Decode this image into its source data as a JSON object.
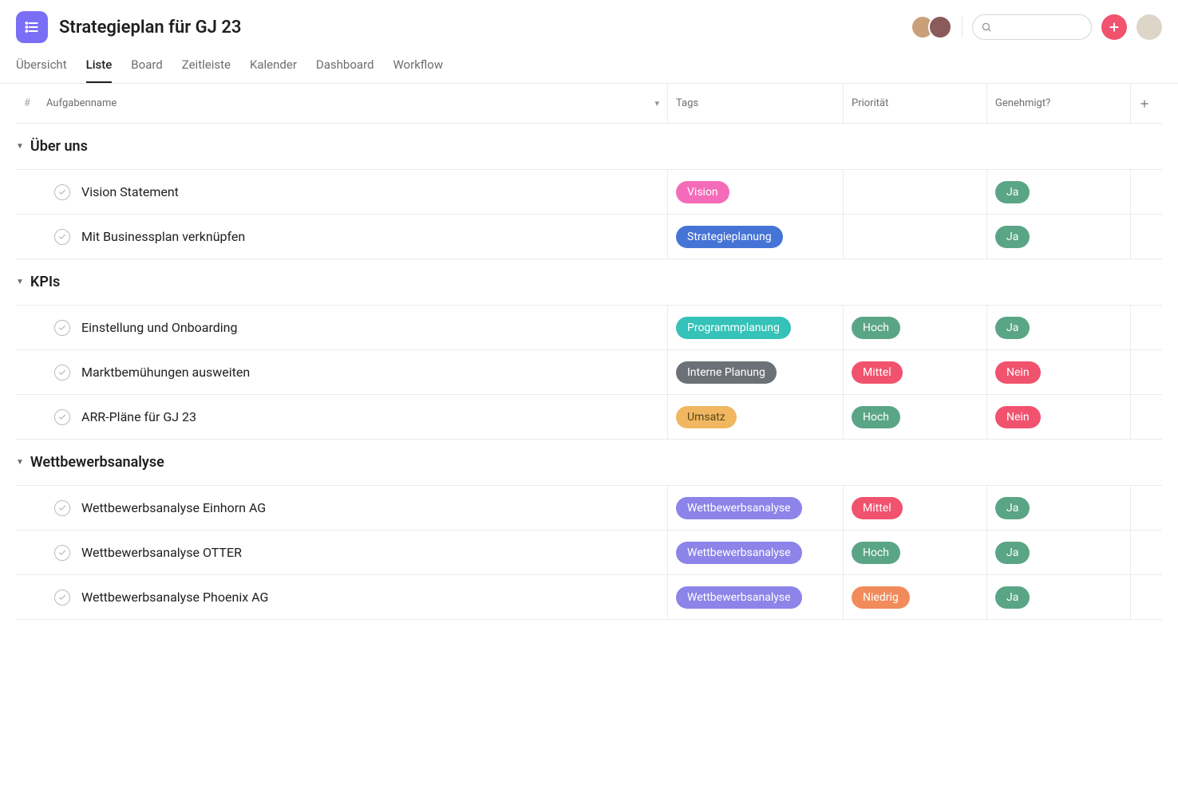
{
  "header": {
    "title": "Strategieplan für GJ 23"
  },
  "tabs": [
    {
      "id": "uebersicht",
      "label": "Übersicht",
      "active": false
    },
    {
      "id": "liste",
      "label": "Liste",
      "active": true
    },
    {
      "id": "board",
      "label": "Board",
      "active": false
    },
    {
      "id": "zeitleiste",
      "label": "Zeitleiste",
      "active": false
    },
    {
      "id": "kalender",
      "label": "Kalender",
      "active": false
    },
    {
      "id": "dashboard",
      "label": "Dashboard",
      "active": false
    },
    {
      "id": "workflow",
      "label": "Workflow",
      "active": false
    }
  ],
  "columns": {
    "num": "#",
    "name": "Aufgabenname",
    "tags": "Tags",
    "priority": "Priorität",
    "approved": "Genehmigt?"
  },
  "sections": [
    {
      "id": "ueber-uns",
      "title": "Über uns",
      "rows": [
        {
          "name": "Vision Statement",
          "tag": "Vision",
          "tagClass": "tag-vision",
          "priority": "",
          "prioClass": "",
          "approved": "Ja",
          "apprClass": "appr-ja"
        },
        {
          "name": "Mit Businessplan verknüpfen",
          "tag": "Strategieplanung",
          "tagClass": "tag-strategieplanung",
          "priority": "",
          "prioClass": "",
          "approved": "Ja",
          "apprClass": "appr-ja"
        }
      ]
    },
    {
      "id": "kpis",
      "title": "KPIs",
      "rows": [
        {
          "name": "Einstellung und Onboarding",
          "tag": "Programmplanung",
          "tagClass": "tag-programmplanung",
          "priority": "Hoch",
          "prioClass": "prio-hoch",
          "approved": "Ja",
          "apprClass": "appr-ja"
        },
        {
          "name": "Marktbemühungen ausweiten",
          "tag": "Interne Planung",
          "tagClass": "tag-interne-planung",
          "priority": "Mittel",
          "prioClass": "prio-mittel",
          "approved": "Nein",
          "apprClass": "appr-nein"
        },
        {
          "name": "ARR-Pläne für GJ 23",
          "tag": "Umsatz",
          "tagClass": "tag-umsatz",
          "priority": "Hoch",
          "prioClass": "prio-hoch",
          "approved": "Nein",
          "apprClass": "appr-nein"
        }
      ]
    },
    {
      "id": "wettbewerb",
      "title": "Wettbewerbsanalyse",
      "rows": [
        {
          "name": "Wettbewerbsanalyse Einhorn AG",
          "tag": "Wettbewerbsanalyse",
          "tagClass": "tag-wettbewerbsanalyse",
          "priority": "Mittel",
          "prioClass": "prio-mittel",
          "approved": "Ja",
          "apprClass": "appr-ja"
        },
        {
          "name": "Wettbewerbsanalyse OTTER",
          "tag": "Wettbewerbsanalyse",
          "tagClass": "tag-wettbewerbsanalyse",
          "priority": "Hoch",
          "prioClass": "prio-hoch",
          "approved": "Ja",
          "apprClass": "appr-ja"
        },
        {
          "name": "Wettbewerbsanalyse Phoenix AG",
          "tag": "Wettbewerbsanalyse",
          "tagClass": "tag-wettbewerbsanalyse",
          "priority": "Niedrig",
          "prioClass": "prio-niedrig",
          "approved": "Ja",
          "apprClass": "appr-ja"
        }
      ]
    }
  ]
}
